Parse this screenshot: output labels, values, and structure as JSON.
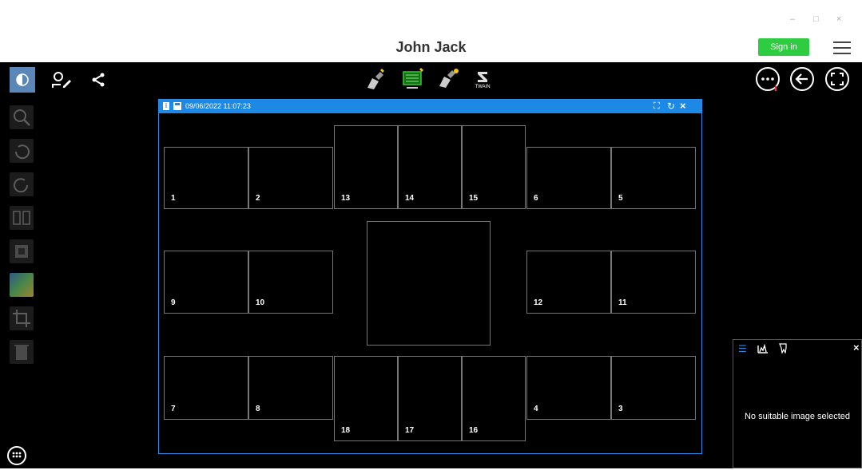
{
  "window": {
    "title": "John Jack",
    "minimize": "–",
    "restore": "□",
    "close": "×"
  },
  "header": {
    "signin_label": "Sign in"
  },
  "toolbar": {
    "twain_label": "TWAIN"
  },
  "viewer": {
    "timestamp": "09/06/2022 11:07:23",
    "cells": [
      {
        "label": "1"
      },
      {
        "label": "2"
      },
      {
        "label": "13"
      },
      {
        "label": "14"
      },
      {
        "label": "15"
      },
      {
        "label": "6"
      },
      {
        "label": "5"
      },
      {
        "label": "9"
      },
      {
        "label": "10"
      },
      {
        "label": "12"
      },
      {
        "label": "11"
      },
      {
        "label": "7"
      },
      {
        "label": "8"
      },
      {
        "label": "18"
      },
      {
        "label": "17"
      },
      {
        "label": "16"
      },
      {
        "label": "4"
      },
      {
        "label": "3"
      }
    ]
  },
  "info_panel": {
    "message": "No suitable image selected",
    "close": "×"
  },
  "colors": {
    "accent": "#1e88e5",
    "signin": "#2ecc40",
    "background": "#000000"
  }
}
